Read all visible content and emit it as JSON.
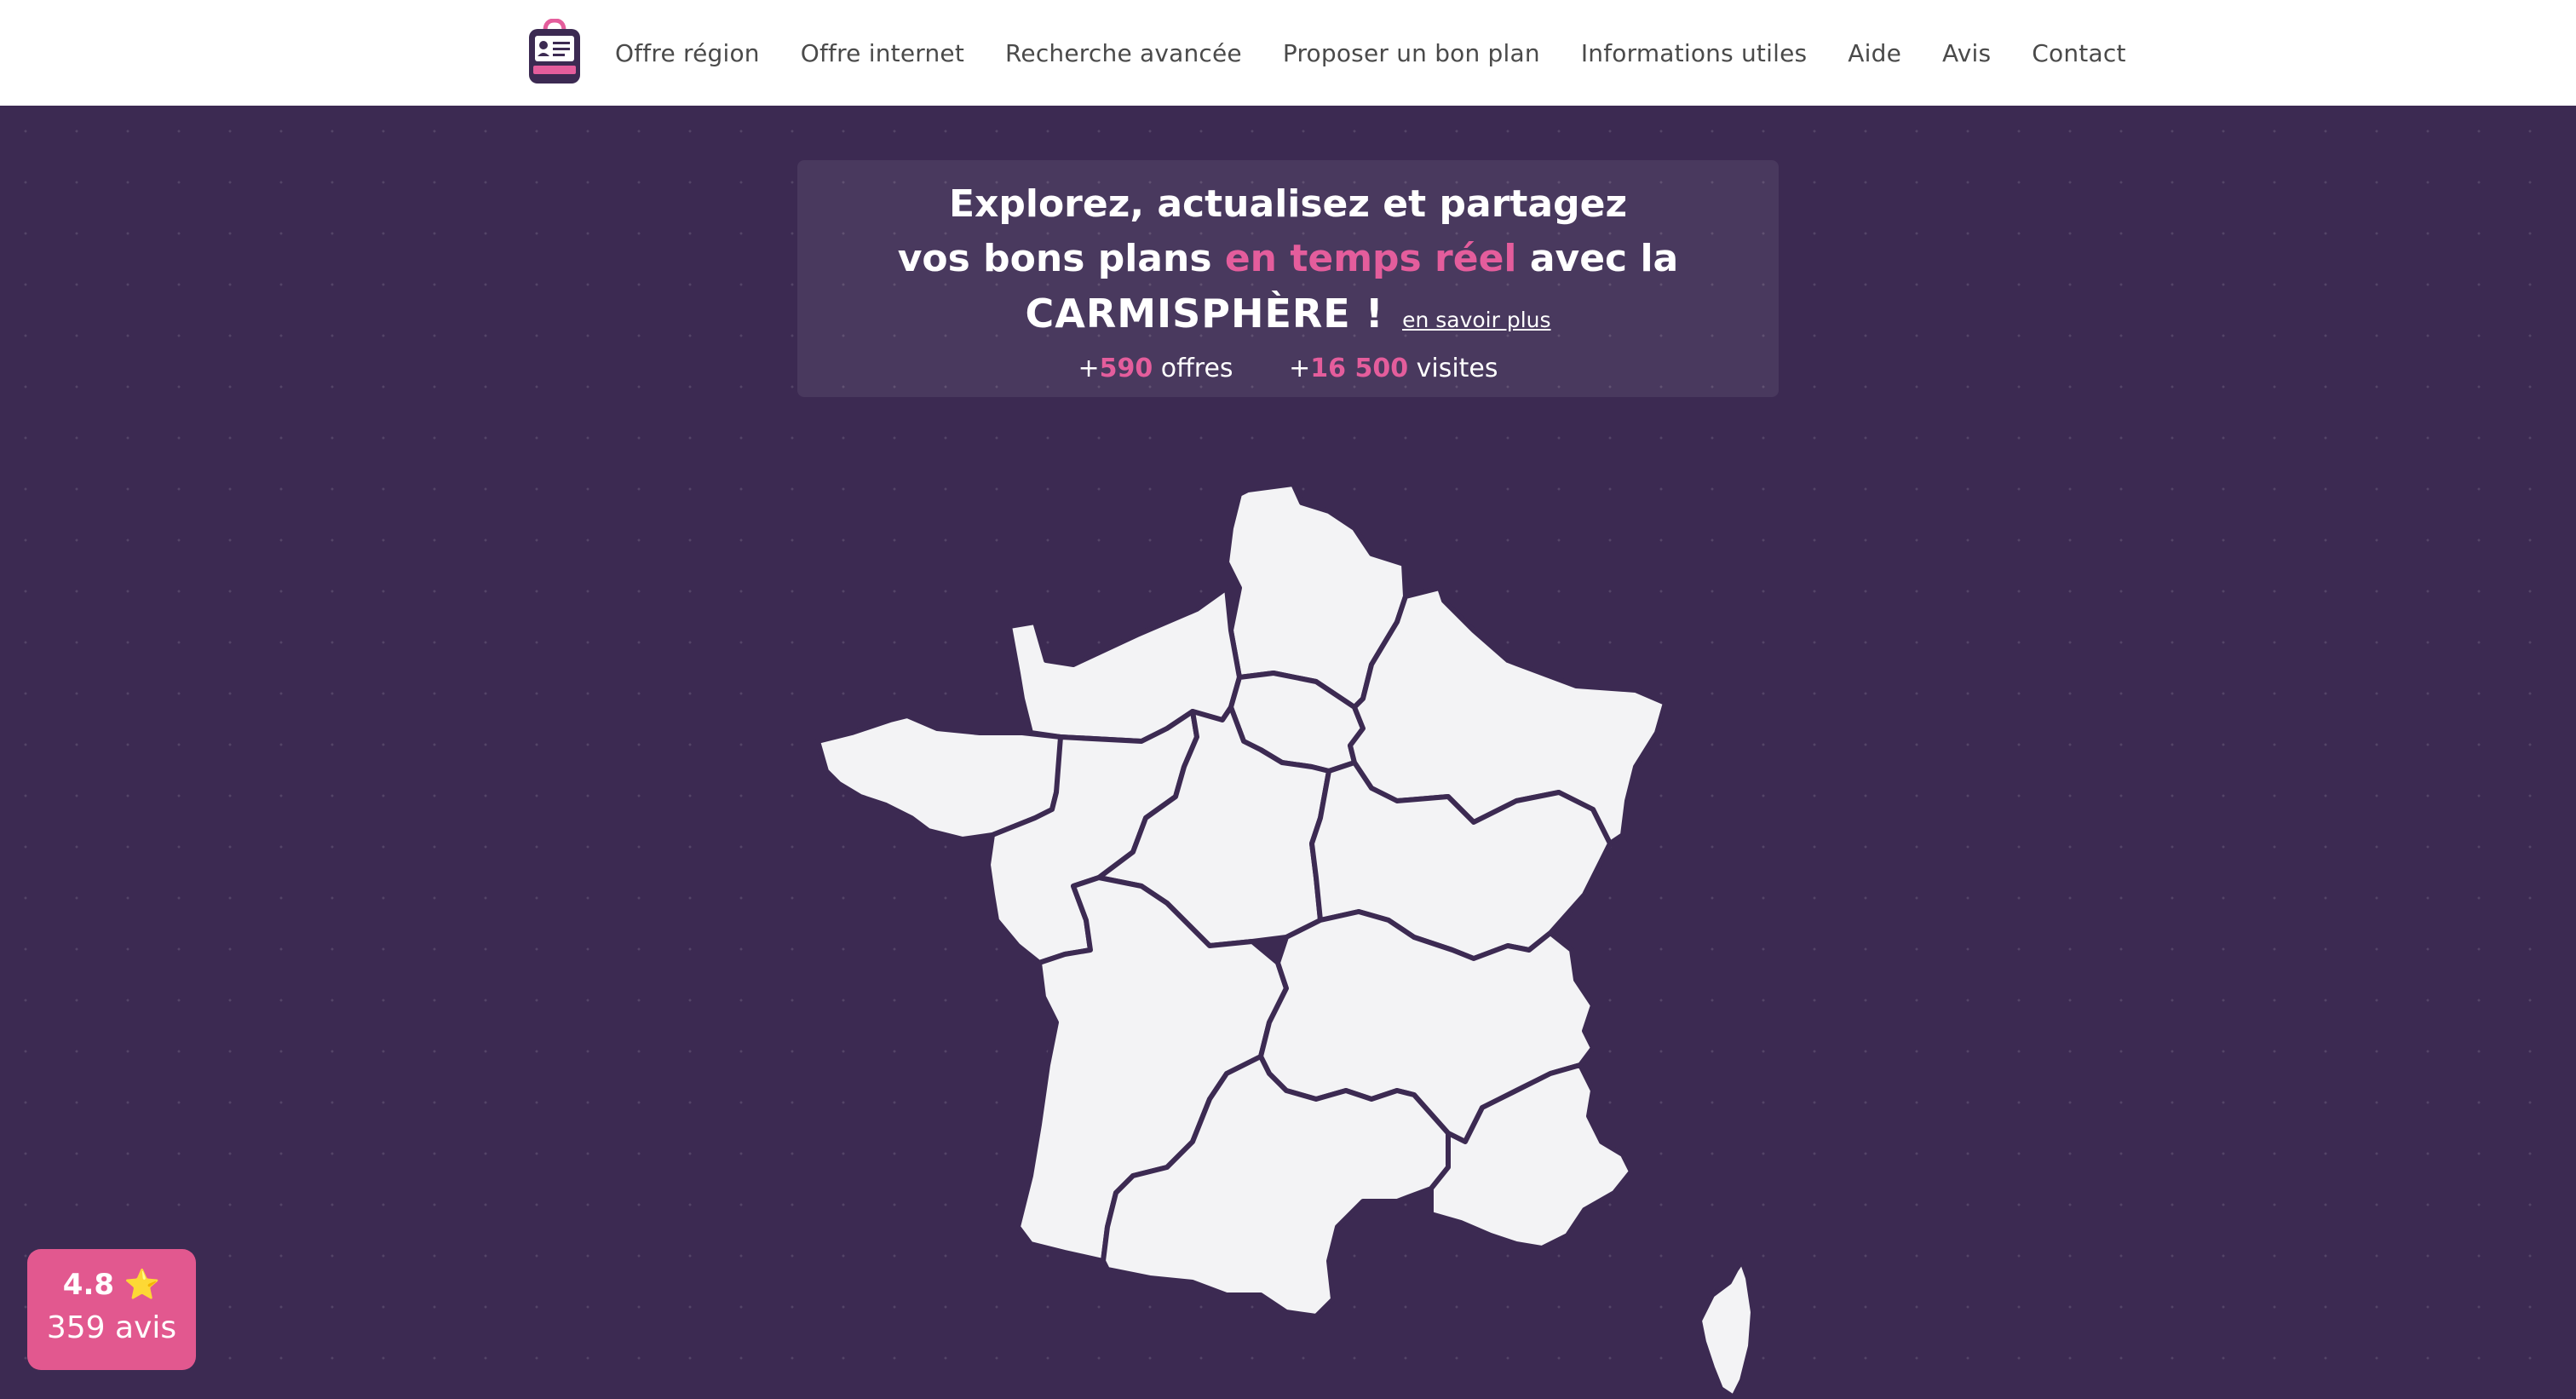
{
  "nav": {
    "logo_text": "CARMISPHÈRE",
    "items": [
      "Offre région",
      "Offre internet",
      "Recherche avancée",
      "Proposer un bon plan",
      "Informations utiles",
      "Aide",
      "Avis",
      "Contact"
    ]
  },
  "hero": {
    "line1": "Explorez, actualisez et partagez",
    "line2_start": "vos bons plans ",
    "line2_highlight": "en temps réel",
    "line2_end": " avec la",
    "brand": "CARMISPHÈRE !",
    "learn_more": "en savoir plus",
    "stat1_prefix": "+",
    "stat1_value": "590",
    "stat1_label": " offres",
    "stat2_prefix": "+",
    "stat2_value": "16 500",
    "stat2_label": " visites"
  },
  "map": {
    "regions": [
      "Hauts-de-France",
      "Normandie",
      "Île-de-France",
      "Grand Est",
      "Bretagne",
      "Pays de la Loire",
      "Centre-Val de Loire",
      "Bourgogne-Franche-Comté",
      "Nouvelle-Aquitaine",
      "Auvergne-Rhône-Alpes",
      "Occitanie",
      "Provence-Alpes-Côte d'Azur",
      "Corse"
    ]
  },
  "rating": {
    "score": "4.8",
    "star": "⭐",
    "count": "359 avis"
  },
  "colors": {
    "background": "#3c2a52",
    "accent": "#e45d9c",
    "map_fill": "#f3f3f5",
    "rating_badge": "#e2588f"
  }
}
